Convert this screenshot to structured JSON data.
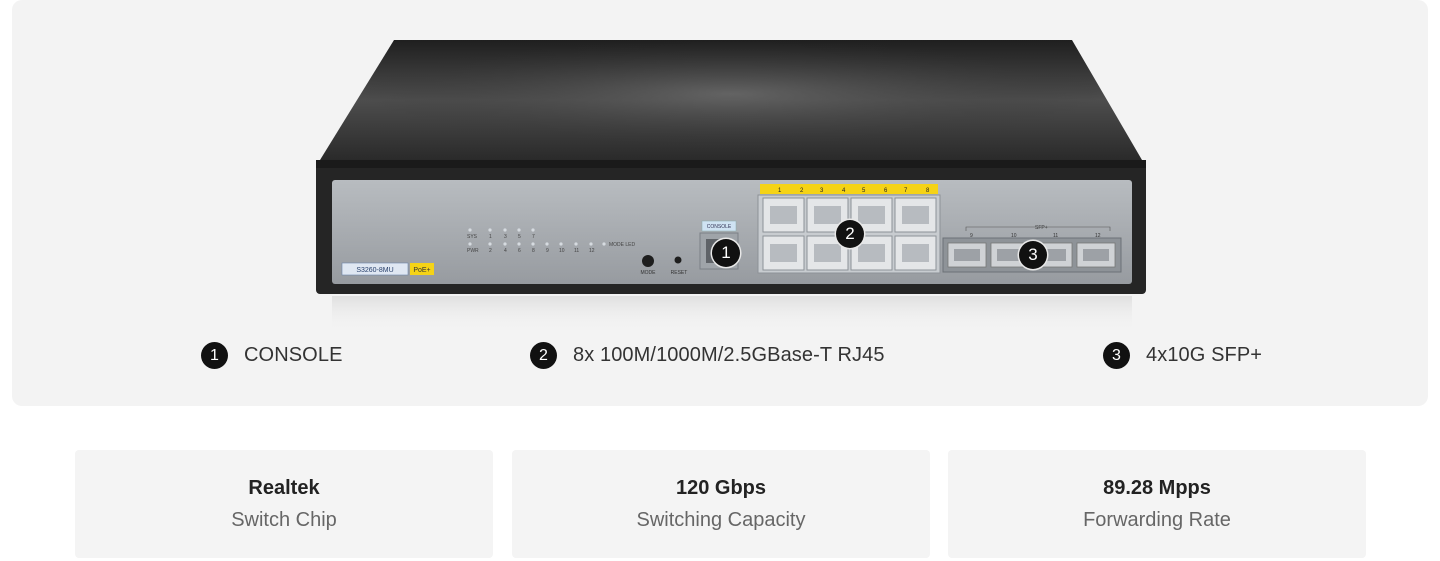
{
  "device": {
    "model_label": "S3260-8MU",
    "poe_label": "PoE+",
    "console_label": "CONSOLE",
    "sfp_label": "SFP+",
    "mode_led_label": "MODE LED",
    "mode_button_label": "MODE",
    "reset_label": "RESET",
    "sys_label": "SYS",
    "pwr_label": "PWR",
    "led_top_numbers": [
      "1",
      "3",
      "5",
      "7"
    ],
    "led_bottom_numbers": [
      "2",
      "4",
      "6",
      "8",
      "9",
      "10",
      "11",
      "12"
    ],
    "rj45_port_labels": [
      "1",
      "2",
      "3",
      "4",
      "5",
      "6",
      "7",
      "8"
    ],
    "sfp_port_numbers": [
      "9",
      "10",
      "11",
      "12"
    ],
    "callouts": [
      "1",
      "2",
      "3"
    ]
  },
  "legend": [
    {
      "number": "1",
      "label": "CONSOLE"
    },
    {
      "number": "2",
      "label": "8x 100M/1000M/2.5GBase-T RJ45"
    },
    {
      "number": "3",
      "label": "4x10G SFP+"
    }
  ],
  "specs": [
    {
      "value": "Realtek",
      "label": "Switch Chip"
    },
    {
      "value": "120 Gbps",
      "label": "Switching Capacity"
    },
    {
      "value": "89.28 Mpps",
      "label": "Forwarding Rate"
    }
  ],
  "colors": {
    "hero_bg": "#f3f3f3",
    "card_bg": "#f4f4f4",
    "chassis": "#2b2b2b",
    "panel": "#a9adb2",
    "poe_yellow": "#f5d316"
  }
}
